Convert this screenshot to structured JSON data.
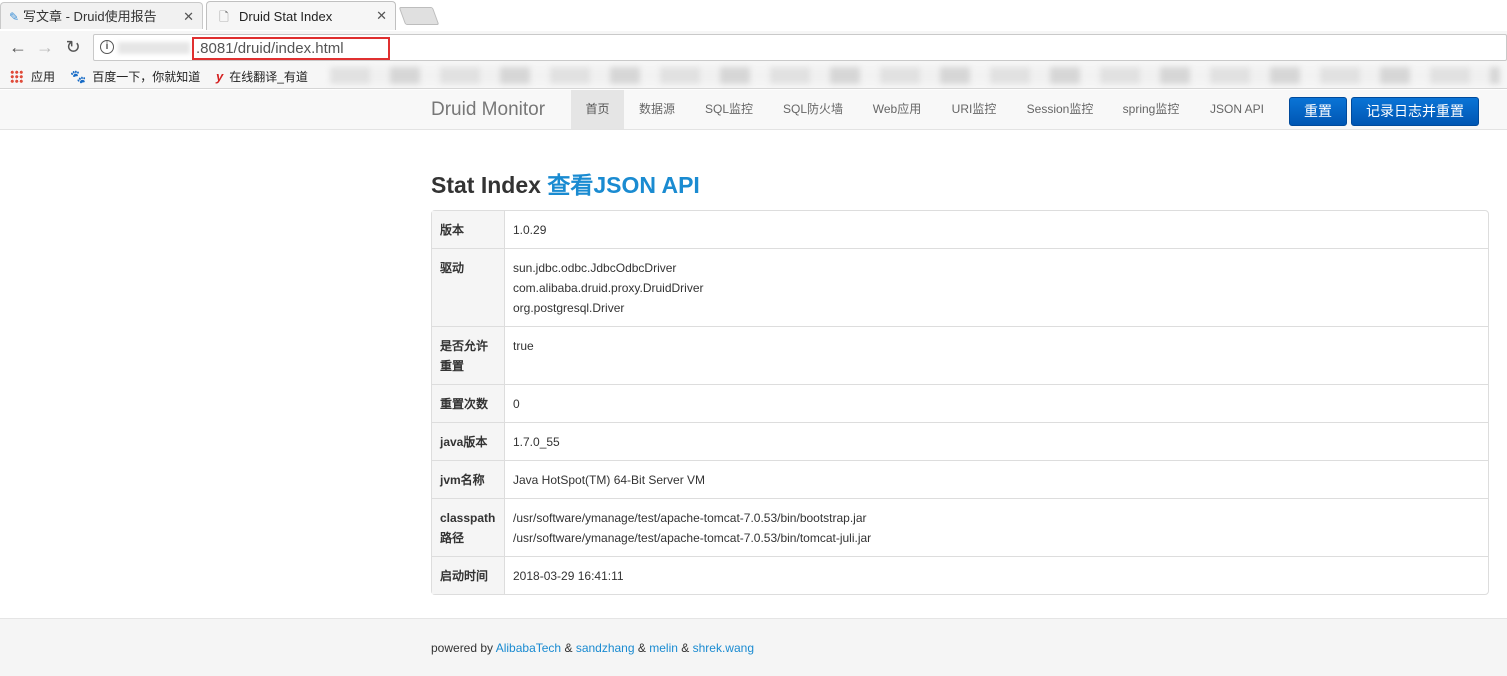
{
  "browser": {
    "tabs": [
      {
        "title": "写文章 - Druid使用报告",
        "active": false
      },
      {
        "title": "Druid Stat Index",
        "active": true
      }
    ],
    "url": ".8081/druid/index.html",
    "bookmarks": [
      {
        "label": "应用"
      },
      {
        "label": "百度一下，你就知道"
      },
      {
        "label": "在线翻译_有道"
      }
    ]
  },
  "navbar": {
    "brand": "Druid Monitor",
    "items": [
      {
        "label": "首页",
        "active": true
      },
      {
        "label": "数据源"
      },
      {
        "label": "SQL监控"
      },
      {
        "label": "SQL防火墙"
      },
      {
        "label": "Web应用"
      },
      {
        "label": "URI监控"
      },
      {
        "label": "Session监控"
      },
      {
        "label": "spring监控"
      },
      {
        "label": "JSON API"
      }
    ],
    "reset_button": "重置",
    "log_reset_button": "记录日志并重置"
  },
  "main": {
    "title": "Stat Index",
    "title_link": "查看JSON API",
    "rows": [
      {
        "key": "版本",
        "values": [
          "1.0.29"
        ]
      },
      {
        "key": "驱动",
        "values": [
          "sun.jdbc.odbc.JdbcOdbcDriver",
          "com.alibaba.druid.proxy.DruidDriver",
          "org.postgresql.Driver"
        ]
      },
      {
        "key": "是否允许重置",
        "values": [
          "true"
        ]
      },
      {
        "key": "重置次数",
        "values": [
          "0"
        ]
      },
      {
        "key": "java版本",
        "values": [
          "1.7.0_55"
        ]
      },
      {
        "key": "jvm名称",
        "values": [
          "Java HotSpot(TM) 64-Bit Server VM"
        ]
      },
      {
        "key": "classpath路径",
        "values": [
          "/usr/software/ymanage/test/apache-tomcat-7.0.53/bin/bootstrap.jar",
          "/usr/software/ymanage/test/apache-tomcat-7.0.53/bin/tomcat-juli.jar"
        ]
      },
      {
        "key": "启动时间",
        "values": [
          "2018-03-29 16:41:11"
        ]
      }
    ]
  },
  "footer": {
    "prefix": "powered by",
    "links": [
      "AlibabaTech",
      "sandzhang",
      "melin",
      "shrek.wang"
    ],
    "separator": "&"
  },
  "colors": {
    "link": "#1a8bd1",
    "button": "#0a6cd0",
    "url_highlight": "#e03030"
  }
}
